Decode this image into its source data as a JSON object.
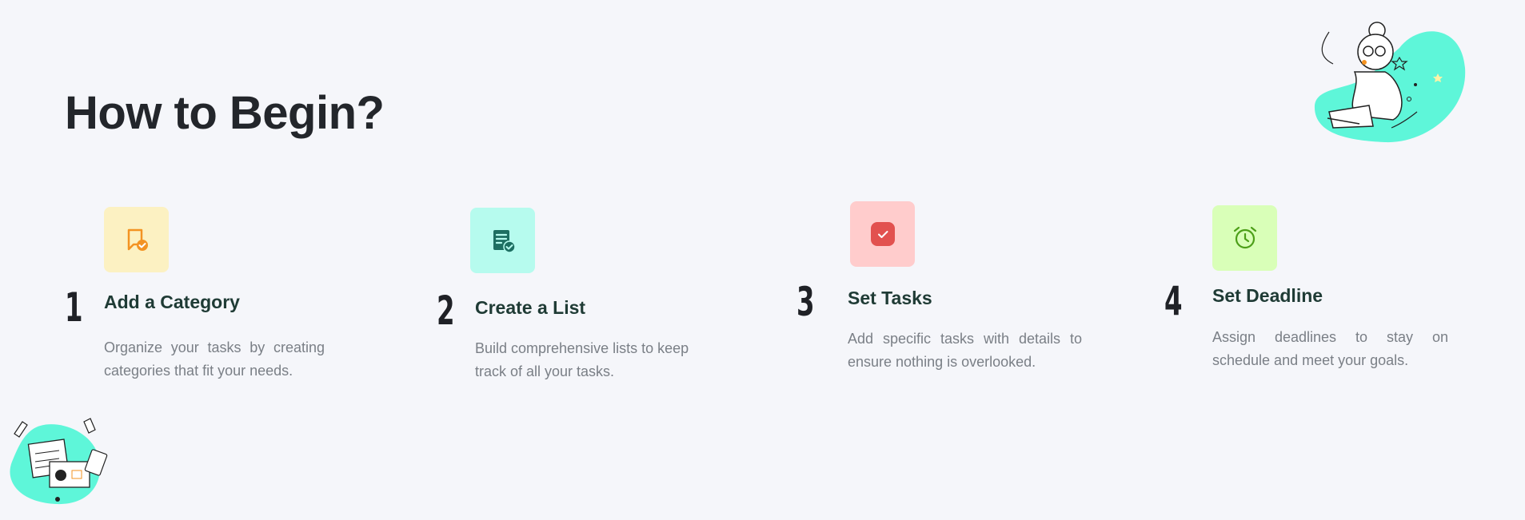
{
  "page": {
    "title": "How to Begin?"
  },
  "steps": [
    {
      "number": "1",
      "title": "Add a Category",
      "description": "Organize your tasks by creating categories that fit your needs.",
      "icon": "category-check-icon",
      "color": "#fcf1c2",
      "icon_color": "#f39322"
    },
    {
      "number": "2",
      "title": "Create a List",
      "description": "Build comprehensive lists to keep track of all your tasks.",
      "icon": "list-check-icon",
      "color": "#b6fbee",
      "icon_color": "#1d6f62"
    },
    {
      "number": "3",
      "title": "Set Tasks",
      "description": "Add specific tasks with details to ensure nothing is overlooked.",
      "icon": "task-check-icon",
      "color": "#ffcccc",
      "icon_color": "#e2514f"
    },
    {
      "number": "4",
      "title": "Set Deadline",
      "description": "Assign deadlines to stay on schedule and meet your goals.",
      "icon": "alarm-clock-icon",
      "color": "#d9ffb8",
      "icon_color": "#4c9f18"
    }
  ],
  "colors": {
    "accent": "#5ef6d9",
    "background": "#f5f6fa"
  },
  "illustrations": [
    "reading-person-illustration",
    "desk-work-illustration"
  ]
}
